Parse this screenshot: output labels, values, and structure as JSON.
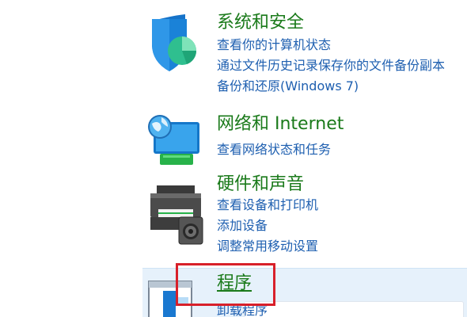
{
  "categories": {
    "security": {
      "title": "系统和安全",
      "icon": "shield-icon",
      "links": [
        "查看你的计算机状态",
        "通过文件历史记录保存你的文件备份副本",
        "备份和还原(Windows 7)"
      ]
    },
    "network": {
      "title": "网络和 Internet",
      "icon": "network-globe-icon",
      "links": [
        "查看网络状态和任务"
      ]
    },
    "hardware": {
      "title": "硬件和声音",
      "icon": "printer-speaker-icon",
      "links": [
        "查看设备和打印机",
        "添加设备",
        "调整常用移动设置"
      ]
    },
    "programs": {
      "title": "程序",
      "icon": "programs-icon",
      "links": [
        "卸载程序"
      ]
    }
  },
  "colors": {
    "title_green": "#1a7a1a",
    "link_blue": "#1e5fb0",
    "highlight_bg": "#e6f1fb",
    "annotation_red": "#d8202a"
  }
}
